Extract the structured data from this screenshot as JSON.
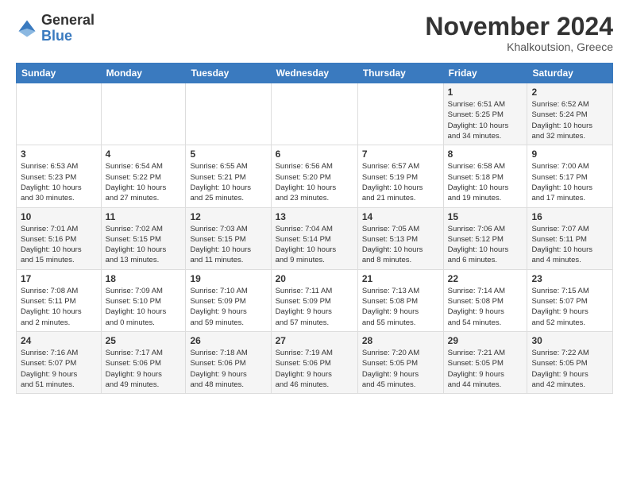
{
  "header": {
    "logo_general": "General",
    "logo_blue": "Blue",
    "month_title": "November 2024",
    "location": "Khalkoutsion, Greece"
  },
  "weekdays": [
    "Sunday",
    "Monday",
    "Tuesday",
    "Wednesday",
    "Thursday",
    "Friday",
    "Saturday"
  ],
  "weeks": [
    [
      {
        "day": "",
        "info": ""
      },
      {
        "day": "",
        "info": ""
      },
      {
        "day": "",
        "info": ""
      },
      {
        "day": "",
        "info": ""
      },
      {
        "day": "",
        "info": ""
      },
      {
        "day": "1",
        "info": "Sunrise: 6:51 AM\nSunset: 5:25 PM\nDaylight: 10 hours\nand 34 minutes."
      },
      {
        "day": "2",
        "info": "Sunrise: 6:52 AM\nSunset: 5:24 PM\nDaylight: 10 hours\nand 32 minutes."
      }
    ],
    [
      {
        "day": "3",
        "info": "Sunrise: 6:53 AM\nSunset: 5:23 PM\nDaylight: 10 hours\nand 30 minutes."
      },
      {
        "day": "4",
        "info": "Sunrise: 6:54 AM\nSunset: 5:22 PM\nDaylight: 10 hours\nand 27 minutes."
      },
      {
        "day": "5",
        "info": "Sunrise: 6:55 AM\nSunset: 5:21 PM\nDaylight: 10 hours\nand 25 minutes."
      },
      {
        "day": "6",
        "info": "Sunrise: 6:56 AM\nSunset: 5:20 PM\nDaylight: 10 hours\nand 23 minutes."
      },
      {
        "day": "7",
        "info": "Sunrise: 6:57 AM\nSunset: 5:19 PM\nDaylight: 10 hours\nand 21 minutes."
      },
      {
        "day": "8",
        "info": "Sunrise: 6:58 AM\nSunset: 5:18 PM\nDaylight: 10 hours\nand 19 minutes."
      },
      {
        "day": "9",
        "info": "Sunrise: 7:00 AM\nSunset: 5:17 PM\nDaylight: 10 hours\nand 17 minutes."
      }
    ],
    [
      {
        "day": "10",
        "info": "Sunrise: 7:01 AM\nSunset: 5:16 PM\nDaylight: 10 hours\nand 15 minutes."
      },
      {
        "day": "11",
        "info": "Sunrise: 7:02 AM\nSunset: 5:15 PM\nDaylight: 10 hours\nand 13 minutes."
      },
      {
        "day": "12",
        "info": "Sunrise: 7:03 AM\nSunset: 5:15 PM\nDaylight: 10 hours\nand 11 minutes."
      },
      {
        "day": "13",
        "info": "Sunrise: 7:04 AM\nSunset: 5:14 PM\nDaylight: 10 hours\nand 9 minutes."
      },
      {
        "day": "14",
        "info": "Sunrise: 7:05 AM\nSunset: 5:13 PM\nDaylight: 10 hours\nand 8 minutes."
      },
      {
        "day": "15",
        "info": "Sunrise: 7:06 AM\nSunset: 5:12 PM\nDaylight: 10 hours\nand 6 minutes."
      },
      {
        "day": "16",
        "info": "Sunrise: 7:07 AM\nSunset: 5:11 PM\nDaylight: 10 hours\nand 4 minutes."
      }
    ],
    [
      {
        "day": "17",
        "info": "Sunrise: 7:08 AM\nSunset: 5:11 PM\nDaylight: 10 hours\nand 2 minutes."
      },
      {
        "day": "18",
        "info": "Sunrise: 7:09 AM\nSunset: 5:10 PM\nDaylight: 10 hours\nand 0 minutes."
      },
      {
        "day": "19",
        "info": "Sunrise: 7:10 AM\nSunset: 5:09 PM\nDaylight: 9 hours\nand 59 minutes."
      },
      {
        "day": "20",
        "info": "Sunrise: 7:11 AM\nSunset: 5:09 PM\nDaylight: 9 hours\nand 57 minutes."
      },
      {
        "day": "21",
        "info": "Sunrise: 7:13 AM\nSunset: 5:08 PM\nDaylight: 9 hours\nand 55 minutes."
      },
      {
        "day": "22",
        "info": "Sunrise: 7:14 AM\nSunset: 5:08 PM\nDaylight: 9 hours\nand 54 minutes."
      },
      {
        "day": "23",
        "info": "Sunrise: 7:15 AM\nSunset: 5:07 PM\nDaylight: 9 hours\nand 52 minutes."
      }
    ],
    [
      {
        "day": "24",
        "info": "Sunrise: 7:16 AM\nSunset: 5:07 PM\nDaylight: 9 hours\nand 51 minutes."
      },
      {
        "day": "25",
        "info": "Sunrise: 7:17 AM\nSunset: 5:06 PM\nDaylight: 9 hours\nand 49 minutes."
      },
      {
        "day": "26",
        "info": "Sunrise: 7:18 AM\nSunset: 5:06 PM\nDaylight: 9 hours\nand 48 minutes."
      },
      {
        "day": "27",
        "info": "Sunrise: 7:19 AM\nSunset: 5:06 PM\nDaylight: 9 hours\nand 46 minutes."
      },
      {
        "day": "28",
        "info": "Sunrise: 7:20 AM\nSunset: 5:05 PM\nDaylight: 9 hours\nand 45 minutes."
      },
      {
        "day": "29",
        "info": "Sunrise: 7:21 AM\nSunset: 5:05 PM\nDaylight: 9 hours\nand 44 minutes."
      },
      {
        "day": "30",
        "info": "Sunrise: 7:22 AM\nSunset: 5:05 PM\nDaylight: 9 hours\nand 42 minutes."
      }
    ]
  ]
}
